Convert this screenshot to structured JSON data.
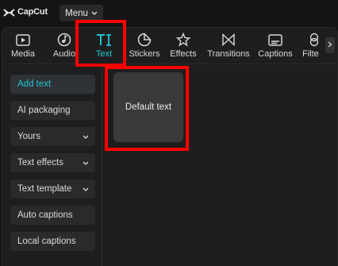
{
  "app": {
    "name": "CapCut"
  },
  "titlebar": {
    "menu_label": "Menu"
  },
  "tabs": [
    {
      "label": "Media",
      "icon": "media-icon"
    },
    {
      "label": "Audio",
      "icon": "audio-icon"
    },
    {
      "label": "Text",
      "icon": "text-icon",
      "active": true
    },
    {
      "label": "Stickers",
      "icon": "stickers-icon"
    },
    {
      "label": "Effects",
      "icon": "effects-icon"
    },
    {
      "label": "Transitions",
      "icon": "transitions-icon"
    },
    {
      "label": "Captions",
      "icon": "captions-icon"
    },
    {
      "label": "Filte",
      "icon": "filters-icon"
    }
  ],
  "sidebar": {
    "items": [
      {
        "label": "Add text",
        "active": true
      },
      {
        "label": "AI packaging"
      },
      {
        "label": "Yours",
        "expandable": true
      },
      {
        "label": "Text effects",
        "expandable": true
      },
      {
        "label": "Text template",
        "expandable": true
      },
      {
        "label": "Auto captions"
      },
      {
        "label": "Local captions"
      }
    ]
  },
  "content": {
    "card_label": "Default text"
  },
  "colors": {
    "accent": "#21c6cf",
    "highlight": "#ff0000",
    "background": "#1e1e20"
  }
}
